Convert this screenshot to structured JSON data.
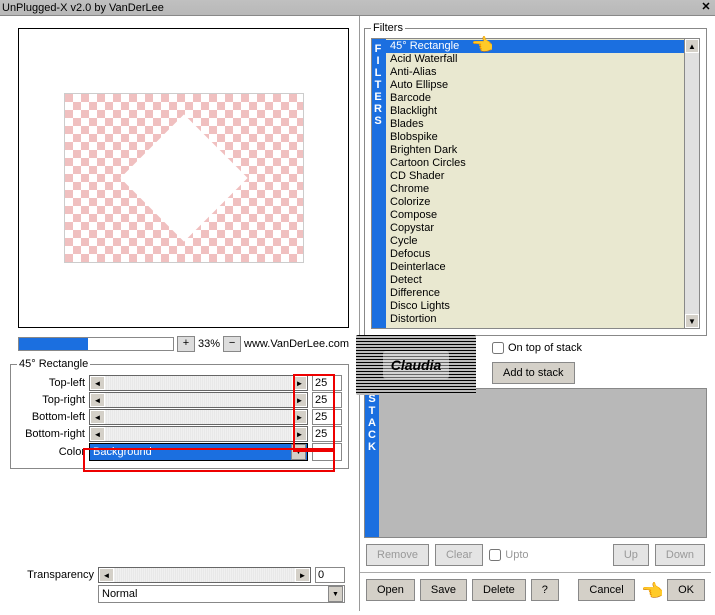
{
  "title": "UnPlugged-X v2.0 by VanDerLee",
  "zoom": {
    "pct": "33%",
    "url": "www.VanDerLee.com"
  },
  "filter_applied": "45° Rectangle",
  "params": {
    "rows": [
      {
        "label": "Top-left",
        "value": "25"
      },
      {
        "label": "Top-right",
        "value": "25"
      },
      {
        "label": "Bottom-left",
        "value": "25"
      },
      {
        "label": "Bottom-right",
        "value": "25"
      }
    ],
    "color_label": "Color",
    "color_value": "Background"
  },
  "transparency": {
    "label": "Transparency",
    "value": "0",
    "mode": "Normal"
  },
  "filters": {
    "legend": "Filters",
    "sidelabel": "FILTERS",
    "items": [
      "45° Rectangle",
      "Acid Waterfall",
      "Anti-Alias",
      "Auto Ellipse",
      "Barcode",
      "Blacklight",
      "Blades",
      "Blobspike",
      "Brighten Dark",
      "Cartoon Circles",
      "CD Shader",
      "Chrome",
      "Colorize",
      "Compose",
      "Copystar",
      "Cycle",
      "Defocus",
      "Deinterlace",
      "Detect",
      "Difference",
      "Disco Lights",
      "Distortion"
    ],
    "selected": 0
  },
  "ontop": "On top of stack",
  "addstack": "Add to stack",
  "stack_side": "STACK",
  "stack_btns": {
    "remove": "Remove",
    "clear": "Clear",
    "upto": "Upto",
    "up": "Up",
    "down": "Down"
  },
  "bottom": {
    "open": "Open",
    "save": "Save",
    "delete": "Delete",
    "help": "?",
    "cancel": "Cancel",
    "ok": "OK"
  },
  "logo": "Claudia"
}
